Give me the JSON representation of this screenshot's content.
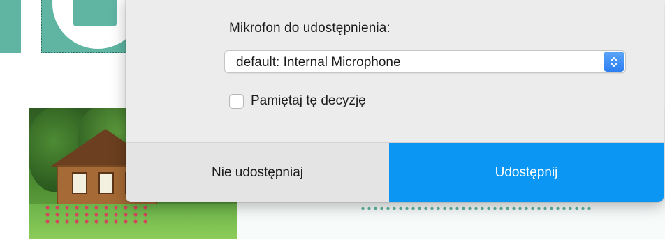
{
  "dialog": {
    "microphone_label": "Mikrofon do udostępnienia:",
    "microphone_select": {
      "value": "default: Internal Microphone",
      "stepper_icon": "up-down-chevron-icon"
    },
    "remember": {
      "label": "Pamiętaj tę decyzję",
      "checked": false
    },
    "buttons": {
      "deny_label": "Nie udostępniaj",
      "allow_label": "Udostępnij"
    }
  },
  "colors": {
    "accent_blue": "#0b96f3",
    "background_teal": "#5fb5a2",
    "dialog_background": "#ececec"
  }
}
